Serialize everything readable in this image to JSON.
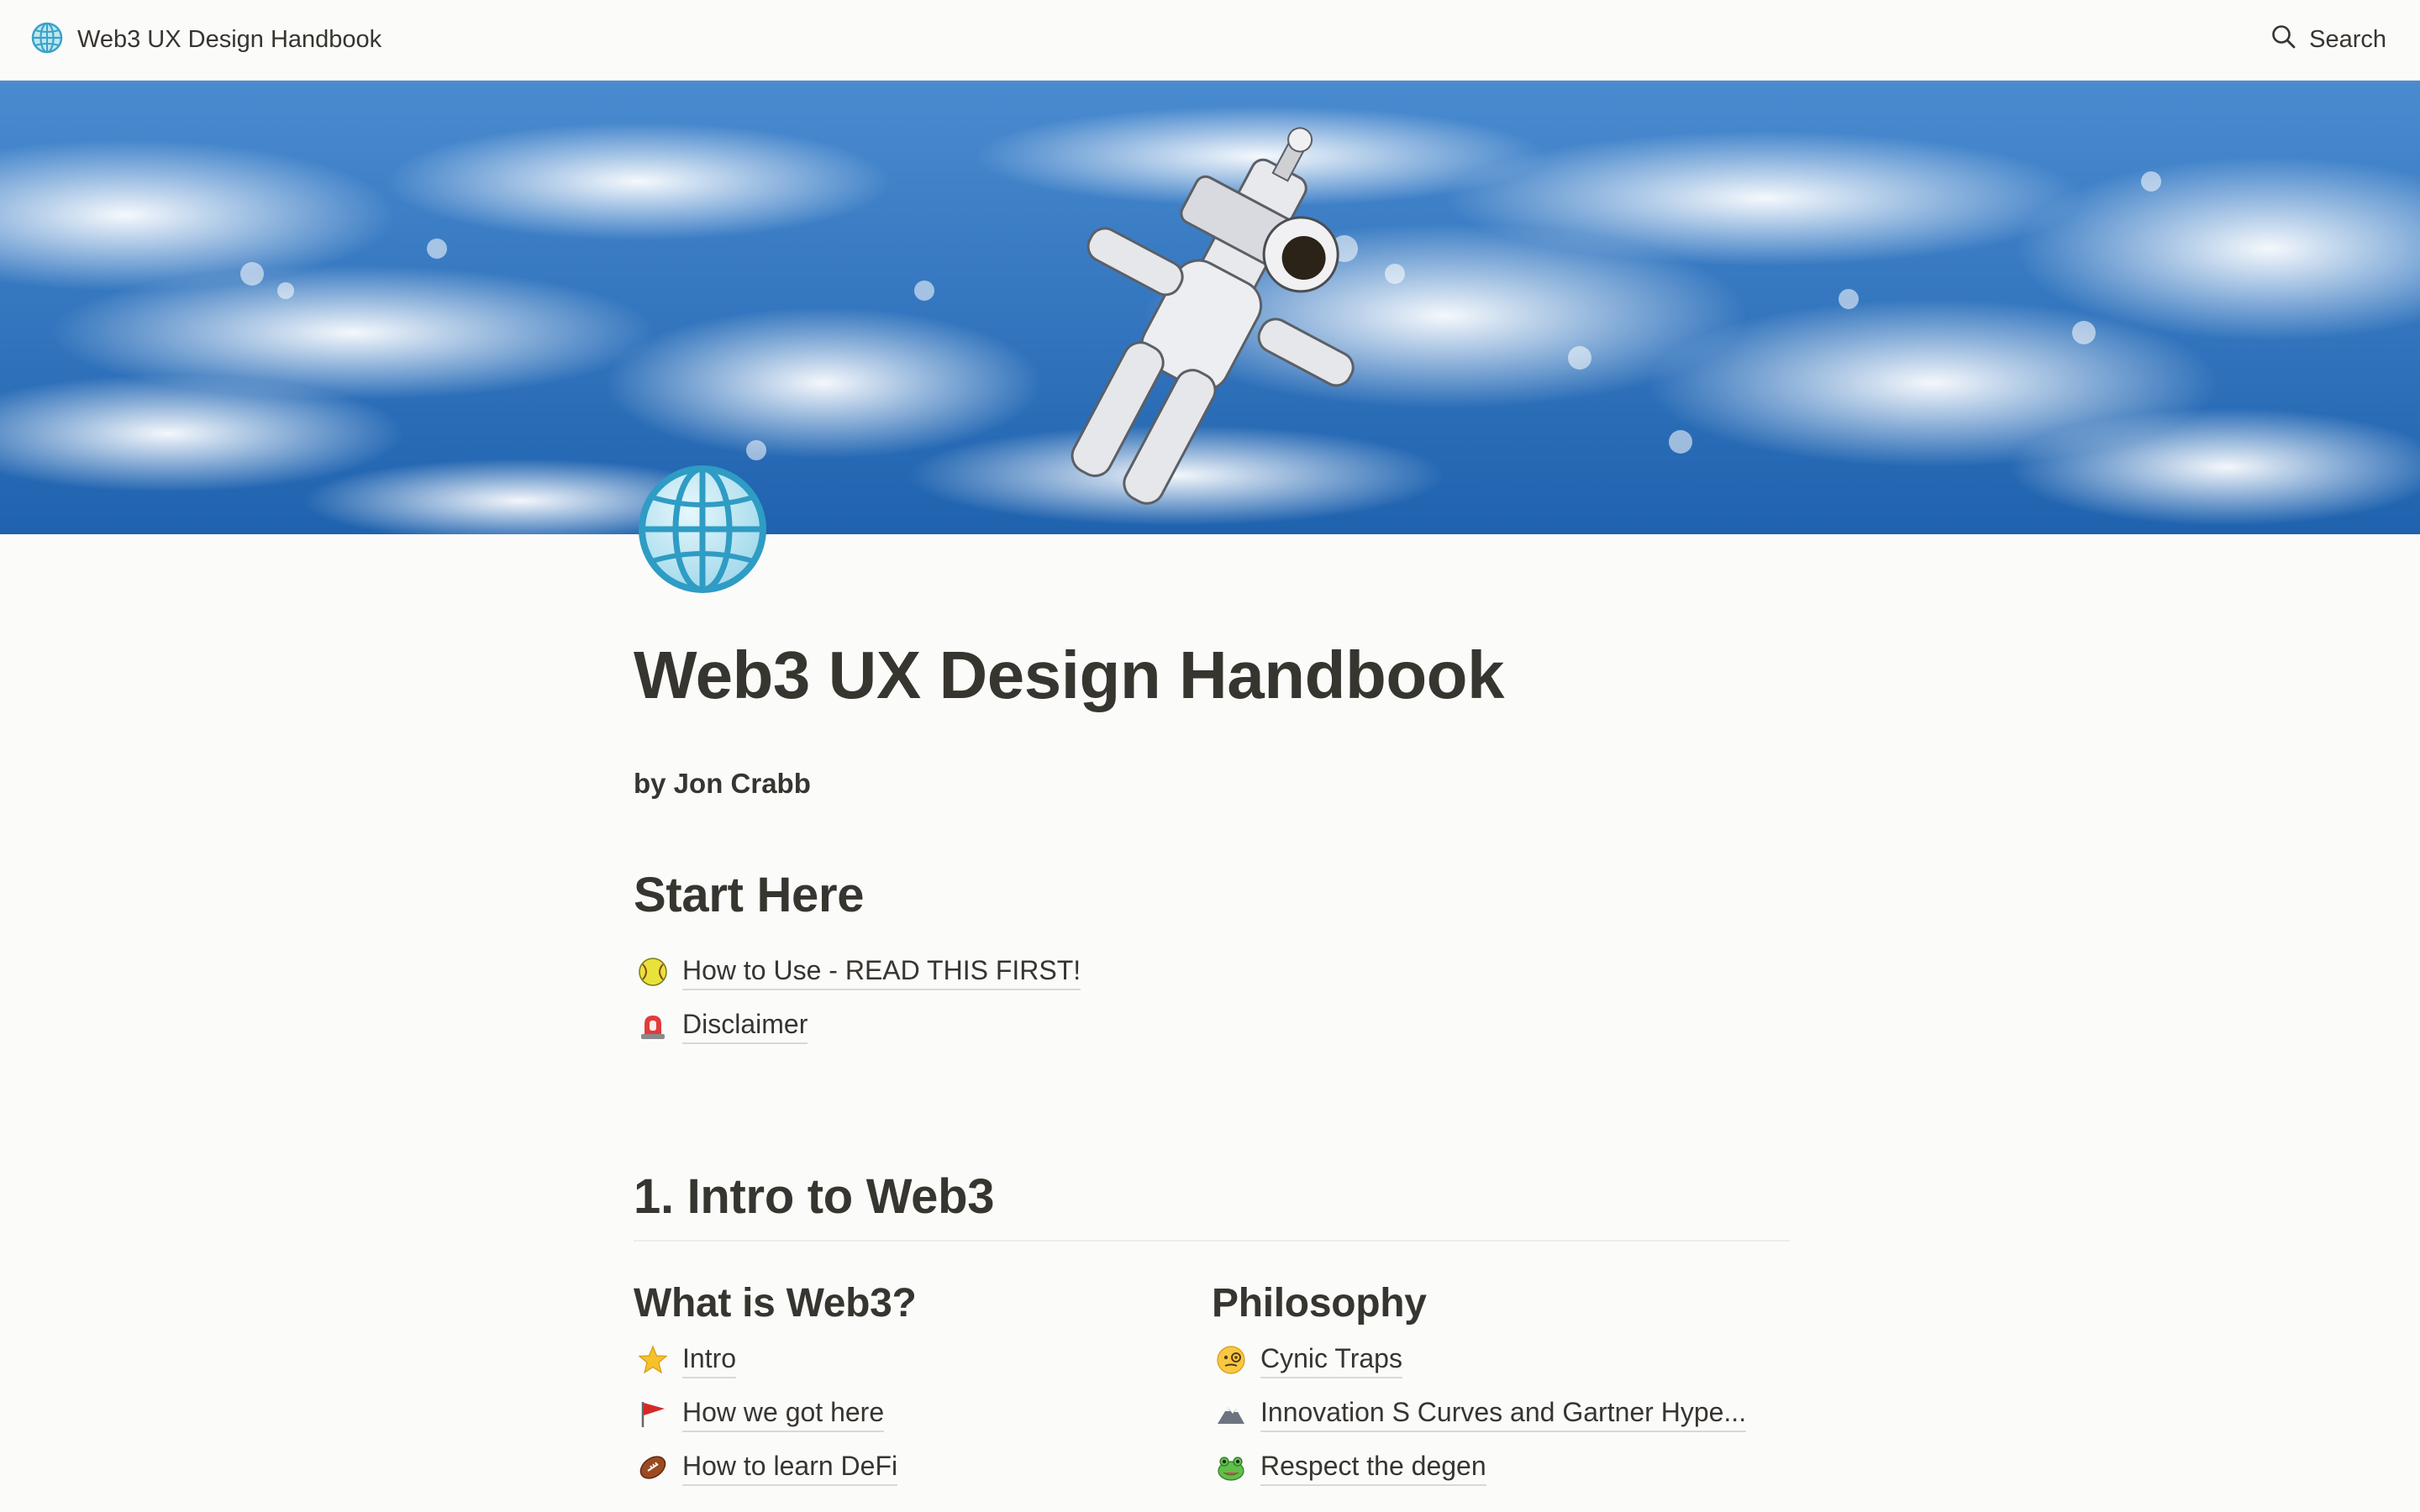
{
  "topbar": {
    "title": "Web3 UX Design Handbook",
    "search_label": "Search",
    "icon": "globe-icon",
    "search_icon": "search-icon"
  },
  "page": {
    "icon": "globe-icon",
    "title": "Web3 UX Design Handbook",
    "byline": "by Jon Crabb"
  },
  "start_here": {
    "heading": "Start Here",
    "items": [
      {
        "label": "How to Use - READ THIS FIRST!",
        "icon": "softball-icon"
      },
      {
        "label": "Disclaimer",
        "icon": "siren-icon"
      }
    ]
  },
  "intro": {
    "heading": "1. Intro to Web3",
    "columns": [
      {
        "heading": "What is Web3?",
        "items": [
          {
            "label": "Intro",
            "icon": "star-icon"
          },
          {
            "label": "How we got here",
            "icon": "flag-icon"
          },
          {
            "label": "How to learn DeFi",
            "icon": "football-icon"
          }
        ]
      },
      {
        "heading": "Philosophy",
        "items": [
          {
            "label": "Cynic Traps",
            "icon": "monocle-face-icon"
          },
          {
            "label": "Innovation S Curves and Gartner Hype...",
            "icon": "mountain-icon"
          },
          {
            "label": "Respect the degen",
            "icon": "frog-icon"
          }
        ]
      }
    ]
  },
  "colors": {
    "text": "#37352f",
    "background": "#fbfbfa",
    "cover_sky": "#2f6fb8"
  }
}
